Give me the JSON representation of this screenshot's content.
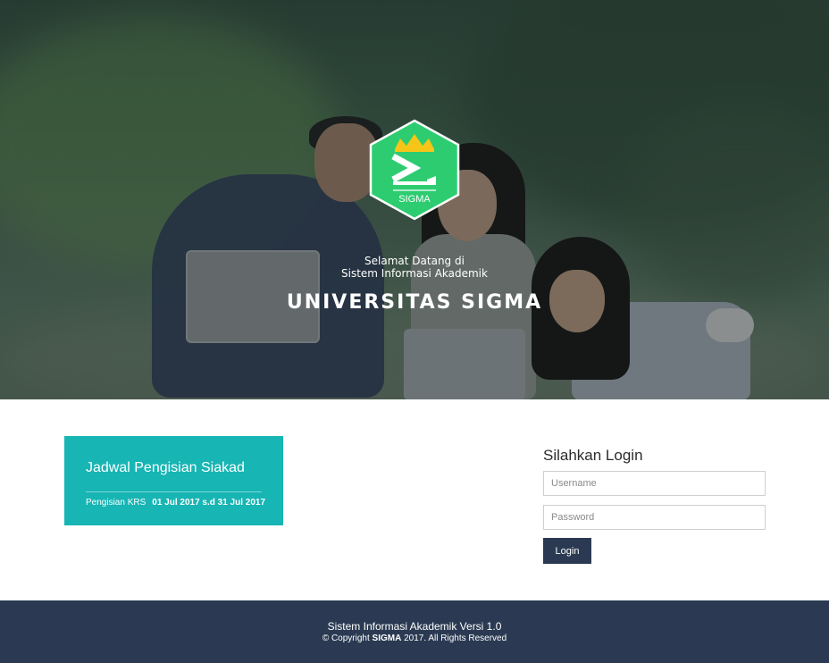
{
  "hero": {
    "logo": {
      "text": "SIGMA",
      "icon": "sigma-crown-logo-icon",
      "colors": {
        "hexagon": "#2ecc71",
        "crown": "#f5c518"
      }
    },
    "welcome_line1": "Selamat Datang di",
    "welcome_line2": "Sistem Informasi Akademik",
    "university": "UNIVERSITAS SIGMA"
  },
  "schedule": {
    "title": "Jadwal Pengisian Siakad",
    "label": "Pengisian KRS",
    "dates": "01 Jul 2017 s.d 31 Jul 2017",
    "color": "#17b5b4"
  },
  "login": {
    "title": "Silahkan Login",
    "username_placeholder": "Username",
    "password_placeholder": "Password",
    "button": "Login",
    "button_color": "#2b3a52"
  },
  "footer": {
    "line1": "Sistem Informasi Akademik Versi 1.0",
    "copyright_prefix": "© Copyright",
    "brand": "SIGMA",
    "copyright_suffix": "2017. All Rights Reserved"
  }
}
